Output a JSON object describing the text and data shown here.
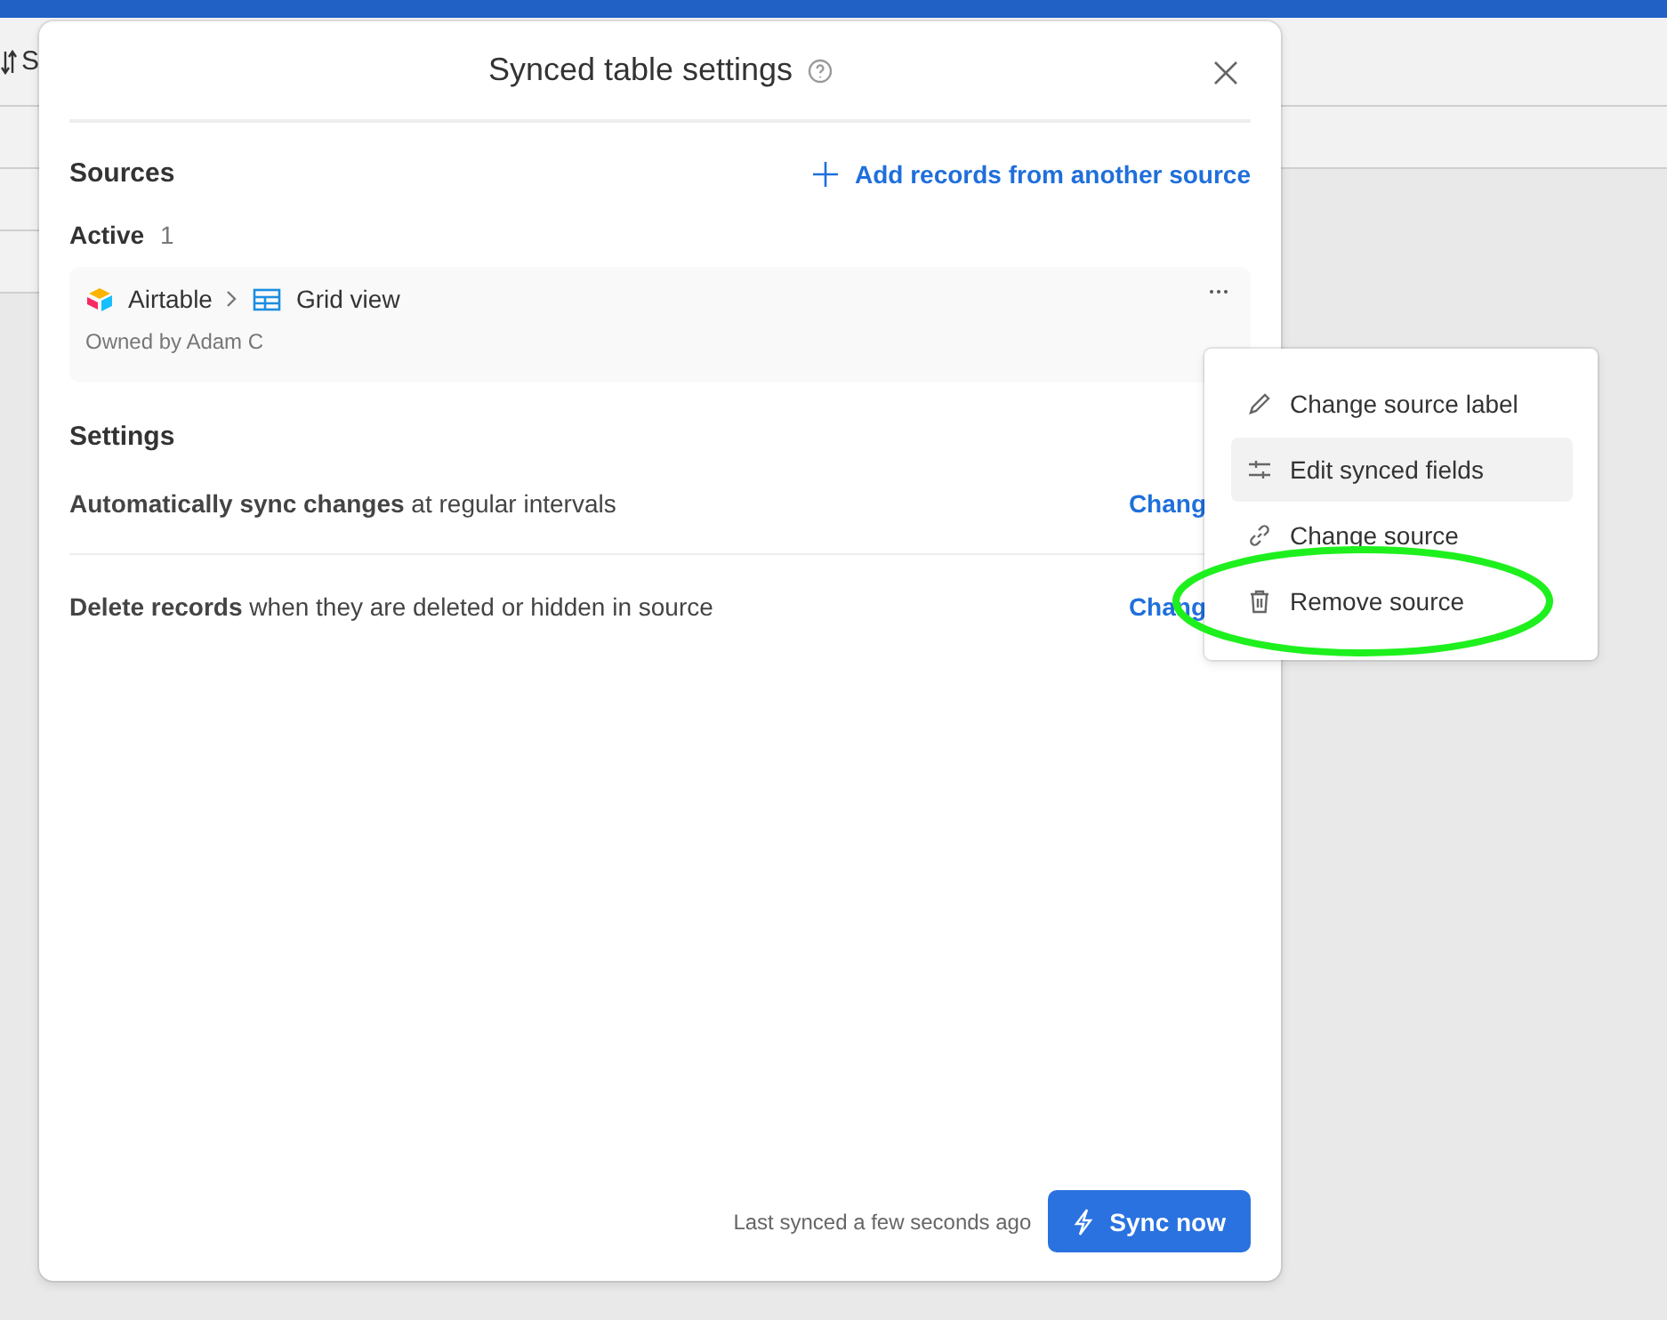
{
  "background": {
    "toolbar_text": "S"
  },
  "dialog": {
    "title": "Synced table settings",
    "sources": {
      "heading": "Sources",
      "add_action": "Add records from another source",
      "active_label": "Active",
      "active_count": "1",
      "items": [
        {
          "base": "Airtable",
          "view": "Grid view",
          "owner": "Owned by Adam C"
        }
      ]
    },
    "settings": {
      "heading": "Settings",
      "rows": [
        {
          "text": "**Automatically sync changes** at regular intervals",
          "action": "Chang"
        },
        {
          "text": "**Delete records** when they are deleted or hidden in source",
          "action": "Chang"
        }
      ]
    },
    "footer": {
      "status": "Last synced a few seconds ago",
      "button": "Sync now"
    }
  },
  "menu": {
    "items": [
      {
        "kind": "edit",
        "label": "Change source label",
        "selected": false
      },
      {
        "kind": "fields",
        "label": "Edit synced fields",
        "selected": true
      },
      {
        "kind": "link",
        "label": "Change source",
        "selected": false
      },
      {
        "kind": "trash",
        "label": "Remove source",
        "selected": false,
        "circled": true
      }
    ]
  }
}
